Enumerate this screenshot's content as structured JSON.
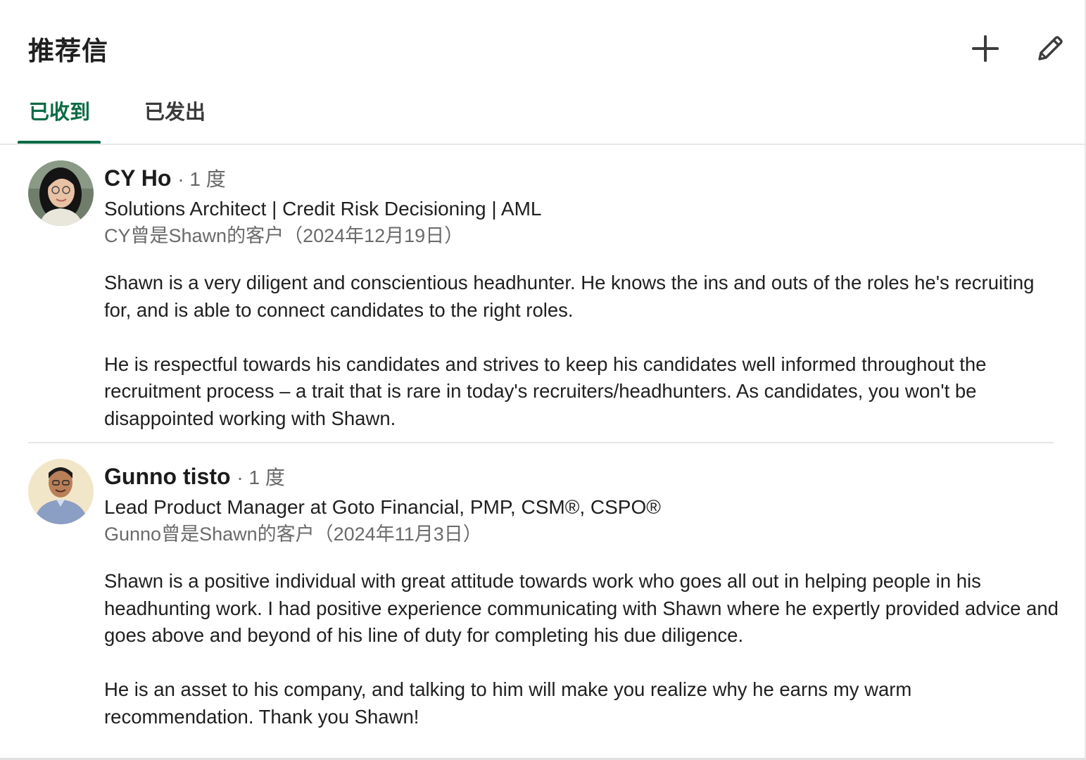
{
  "section": {
    "title": "推荐信",
    "actions": {
      "add_icon": "plus-icon",
      "edit_icon": "pencil-icon"
    }
  },
  "tabs": [
    {
      "label": "已收到",
      "active": true
    },
    {
      "label": "已发出",
      "active": false
    }
  ],
  "recommendations": [
    {
      "name": "CY Ho",
      "degree": "· 1 度",
      "headline": "Solutions Architect | Credit Risk Decisioning | AML",
      "relationship": "CY曾是Shawn的客户（2024年12月19日）",
      "paragraphs": [
        "Shawn is a very diligent and conscientious headhunter. He knows the ins and outs of the roles he's recruiting for, and is able to connect candidates to the right roles.",
        "He is respectful towards his candidates and strives to keep his candidates well informed throughout the recruitment process – a trait that is rare in today's recruiters/headhunters. As candidates, you won't be disappointed working with Shawn."
      ]
    },
    {
      "name": "Gunno tisto",
      "degree": "· 1 度",
      "headline": "Lead Product Manager at Goto Financial, PMP, CSM®, CSPO®",
      "relationship": "Gunno曾是Shawn的客户（2024年11月3日）",
      "paragraphs": [
        "Shawn is a positive individual with great attitude towards work who goes all out in helping people in his headhunting work. I had positive experience communicating with Shawn where he expertly provided advice and goes above and beyond of his line of duty for completing his due diligence.",
        "He is an asset to his company, and talking to him will make you realize why he earns my warm recommendation. Thank you Shawn!"
      ]
    }
  ],
  "colors": {
    "accent": "#0a6b45",
    "secondary_text": "#6a6a6a",
    "divider": "#e6e6e6"
  }
}
